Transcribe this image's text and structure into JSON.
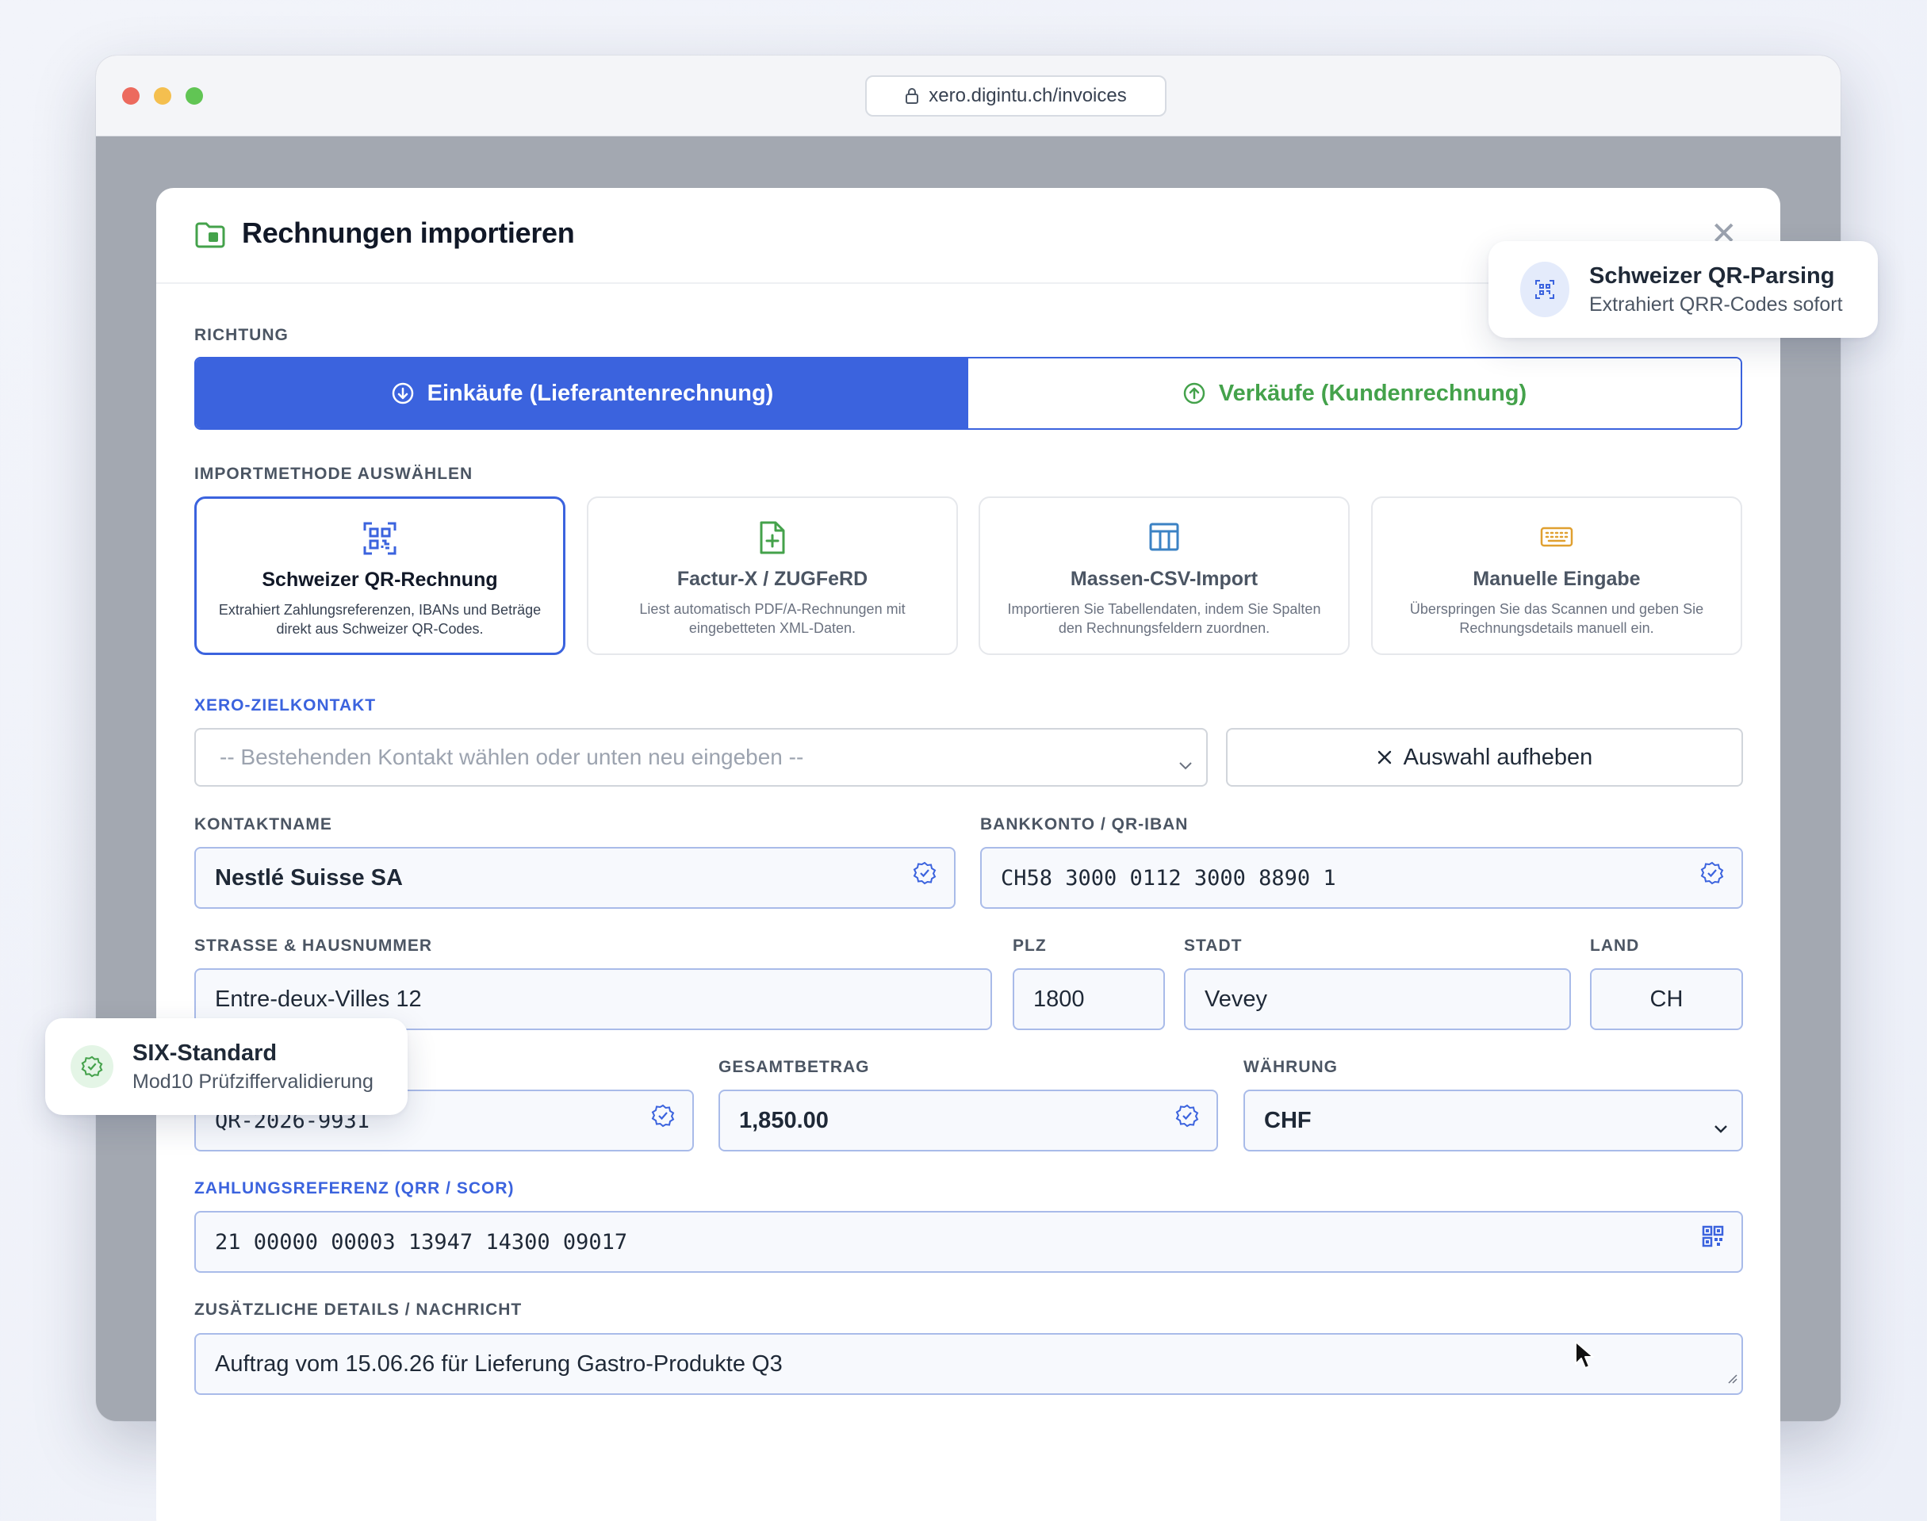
{
  "browser": {
    "url": "xero.digintu.ch/invoices"
  },
  "modal": {
    "title": "Rechnungen importieren",
    "close": "✕"
  },
  "direction": {
    "label": "RICHTUNG",
    "purchases": "Einkäufe (Lieferantenrechnung)",
    "sales": "Verkäufe (Kundenrechnung)",
    "selected": "purchases"
  },
  "methods": {
    "label": "IMPORTMETHODE AUSWÄHLEN",
    "items": [
      {
        "title": "Schweizer QR-Rechnung",
        "desc": "Extrahiert Zahlungsreferenzen, IBANs und Beträge direkt aus Schweizer QR-Codes.",
        "icon": "qr-code-icon",
        "color": "#3b63de",
        "selected": true
      },
      {
        "title": "Factur-X / ZUGFeRD",
        "desc": "Liest automatisch PDF/A-Rechnungen mit eingebetteten XML-Daten.",
        "icon": "file-plus-icon",
        "color": "#44a24b",
        "selected": false
      },
      {
        "title": "Massen-CSV-Import",
        "desc": "Importieren Sie Tabellendaten, indem Sie Spalten den Rechnungsfeldern zuordnen.",
        "icon": "table-icon",
        "color": "#3b82c4",
        "selected": false
      },
      {
        "title": "Manuelle Eingabe",
        "desc": "Überspringen Sie das Scannen und geben Sie Rechnungsdetails manuell ein.",
        "icon": "keyboard-icon",
        "color": "#e0a030",
        "selected": false
      }
    ]
  },
  "contact": {
    "label": "XERO-ZIELKONTAKT",
    "placeholder": "-- Bestehenden Kontakt wählen oder unten neu eingeben --",
    "clear_label": "Auswahl aufheben"
  },
  "form": {
    "contact_name_label": "KONTAKTNAME",
    "contact_name": "Nestlé Suisse SA",
    "iban_label": "BANKKONTO / QR-IBAN",
    "iban": "CH58 3000 0112 3000 8890 1",
    "street_label": "STRASSE & HAUSNUMMER",
    "street": "Entre-deux-Villes 12",
    "zip_label": "PLZ",
    "zip": "1800",
    "city_label": "STADT",
    "city": "Vevey",
    "country_label": "LAND",
    "country": "CH",
    "invoice_no": "QR-2026-9931",
    "total_label": "GESAMTBETRAG",
    "total": "1,850.00",
    "currency_label": "WÄHRUNG",
    "currency": "CHF",
    "reference_label": "ZAHLUNGSREFERENZ (QRR / SCOR)",
    "reference": "21 00000 00003 13947 14300 09017",
    "details_label": "ZUSÄTZLICHE DETAILS / NACHRICHT",
    "details": "Auftrag vom 15.06.26 für Lieferung Gastro-Produkte Q3"
  },
  "badges": {
    "qr": {
      "title": "Schweizer QR-Parsing",
      "sub": "Extrahiert QRR-Codes sofort"
    },
    "six": {
      "title": "SIX-Standard",
      "sub": "Mod10 Prüfziffervalidierung"
    }
  },
  "colors": {
    "accent": "#3b63de",
    "success": "#44a24b"
  }
}
